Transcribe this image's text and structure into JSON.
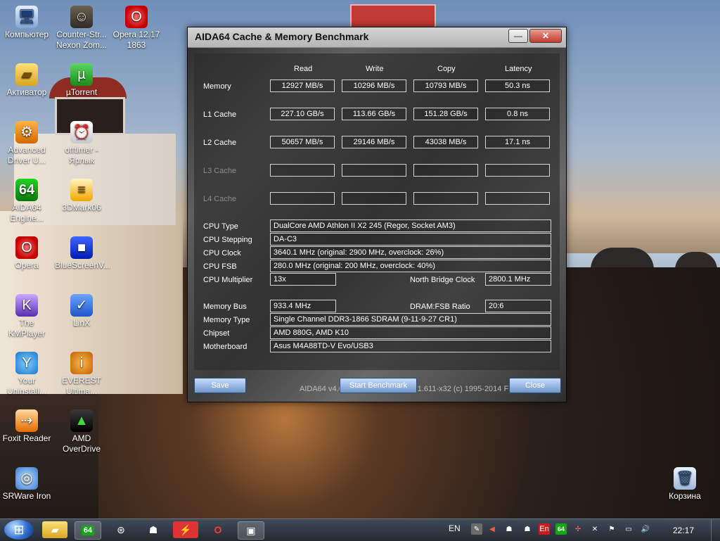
{
  "desktop": {
    "icons": [
      {
        "label": "Компьютер",
        "icon": "computer-icon",
        "glyph": "🖥"
      },
      {
        "label": "Counter-Str... Nexon Zom...",
        "icon": "game-icon",
        "glyph": "☺"
      },
      {
        "label": "Opera 12.17 1863",
        "icon": "opera-icon",
        "glyph": "O"
      },
      {
        "label": "Активатор",
        "icon": "folder-icon",
        "glyph": "▰"
      },
      {
        "label": "µTorrent",
        "icon": "utorrent-icon",
        "glyph": "µ"
      },
      {
        "label": "Advanced Driver U...",
        "icon": "driver-updater-icon",
        "glyph": "⚙"
      },
      {
        "label": "offtimer - Ярлык",
        "icon": "timer-icon",
        "glyph": "⏰"
      },
      {
        "label": "AIDA64 Engine...",
        "icon": "aida64-icon",
        "glyph": "64"
      },
      {
        "label": "3DMark06",
        "icon": "3dmark-icon",
        "glyph": "≡"
      },
      {
        "label": "Opera",
        "icon": "opera-icon",
        "glyph": "O"
      },
      {
        "label": "BlueScreenV...",
        "icon": "bluescreenview-icon",
        "glyph": "■"
      },
      {
        "label": "The KMPlayer",
        "icon": "kmplayer-icon",
        "glyph": "K"
      },
      {
        "label": "LinX",
        "icon": "linx-icon",
        "glyph": "✓"
      },
      {
        "label": "Your Uninstall...",
        "icon": "uninstaller-icon",
        "glyph": "Y"
      },
      {
        "label": "EVEREST Ultima...",
        "icon": "everest-icon",
        "glyph": "i"
      },
      {
        "label": "Foxit Reader",
        "icon": "foxit-icon",
        "glyph": "⇢"
      },
      {
        "label": "AMD OverDrive",
        "icon": "amd-overdrive-icon",
        "glyph": "▲"
      },
      {
        "label": "SRWare Iron",
        "icon": "srware-iron-icon",
        "glyph": "◎"
      },
      {
        "label": "Корзина",
        "icon": "recycle-bin-icon",
        "glyph": "🗑"
      }
    ]
  },
  "window": {
    "title": "AIDA64 Cache & Memory Benchmark",
    "minimize_glyph": "—",
    "close_glyph": "✕",
    "columns": [
      "Read",
      "Write",
      "Copy",
      "Latency"
    ],
    "rows": [
      {
        "label": "Memory",
        "values": [
          "12927 MB/s",
          "10296 MB/s",
          "10793 MB/s",
          "50.3 ns"
        ]
      },
      {
        "label": "L1 Cache",
        "values": [
          "227.10 GB/s",
          "113.66 GB/s",
          "151.28 GB/s",
          "0.8 ns"
        ]
      },
      {
        "label": "L2 Cache",
        "values": [
          "50657 MB/s",
          "29146 MB/s",
          "43038 MB/s",
          "17.1 ns"
        ]
      },
      {
        "label": "L3 Cache",
        "values": [
          "",
          "",
          "",
          ""
        ]
      },
      {
        "label": "L4 Cache",
        "values": [
          "",
          "",
          "",
          ""
        ]
      }
    ],
    "info": {
      "cpu_type": {
        "label": "CPU Type",
        "value": "DualCore AMD Athlon II X2 245  (Regor, Socket AM3)"
      },
      "cpu_stepping": {
        "label": "CPU Stepping",
        "value": "DA-C3"
      },
      "cpu_clock": {
        "label": "CPU Clock",
        "value": "3640.1 MHz  (original: 2900 MHz, overclock: 26%)"
      },
      "cpu_fsb": {
        "label": "CPU FSB",
        "value": "280.0 MHz  (original: 200 MHz, overclock: 40%)"
      },
      "cpu_multiplier": {
        "label": "CPU Multiplier",
        "value": "13x"
      },
      "north_bridge_clock": {
        "label": "North Bridge Clock",
        "value": "2800.1 MHz"
      },
      "memory_bus": {
        "label": "Memory Bus",
        "value": "933.4 MHz"
      },
      "dram_fsb_ratio": {
        "label": "DRAM:FSB Ratio",
        "value": "20:6"
      },
      "memory_type": {
        "label": "Memory Type",
        "value": "Single Channel DDR3-1866 SDRAM  (9-11-9-27 CR1)"
      },
      "chipset": {
        "label": "Chipset",
        "value": "AMD 880G, AMD K10"
      },
      "motherboard": {
        "label": "Motherboard",
        "value": "Asus M4A88TD-V Evo/USB3"
      }
    },
    "footer": "AIDA64 v4.60.3100 / BenchDLL 4.1.611-x32  (c) 1995-2014 FinalWire Ltd.",
    "buttons": {
      "save": "Save",
      "start": "Start Benchmark",
      "close": "Close"
    }
  },
  "taskbar": {
    "language": "EN",
    "time": "22:17",
    "tray_en": "En",
    "tray_64": "64"
  }
}
